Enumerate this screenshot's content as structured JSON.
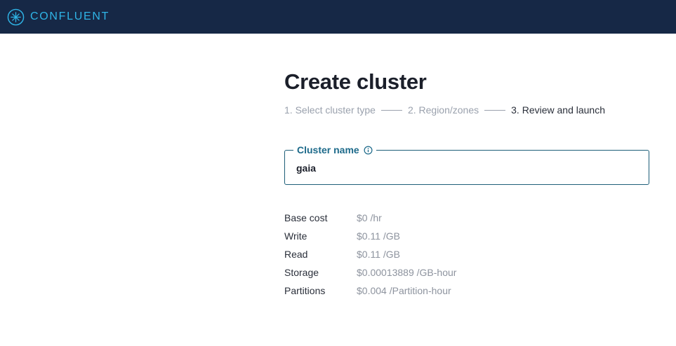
{
  "header": {
    "brand": "CONFLUENT",
    "logo_icon": "confluent-star-icon",
    "background": "#162846",
    "brand_color": "#2fb4e6"
  },
  "page": {
    "title": "Create cluster"
  },
  "steps": [
    {
      "label": "1. Select cluster type",
      "state": "completed"
    },
    {
      "label": "2. Region/zones",
      "state": "completed"
    },
    {
      "label": "3. Review and launch",
      "state": "active"
    }
  ],
  "cluster_name_field": {
    "label": "Cluster name",
    "value": "gaia",
    "info_icon": "info-icon"
  },
  "costs": [
    {
      "label": "Base cost",
      "value": "$0 /hr"
    },
    {
      "label": "Write",
      "value": "$0.11 /GB"
    },
    {
      "label": "Read",
      "value": "$0.11 /GB"
    },
    {
      "label": "Storage",
      "value": "$0.00013889 /GB-hour"
    },
    {
      "label": "Partitions",
      "value": "$0.004 /Partition-hour"
    }
  ]
}
